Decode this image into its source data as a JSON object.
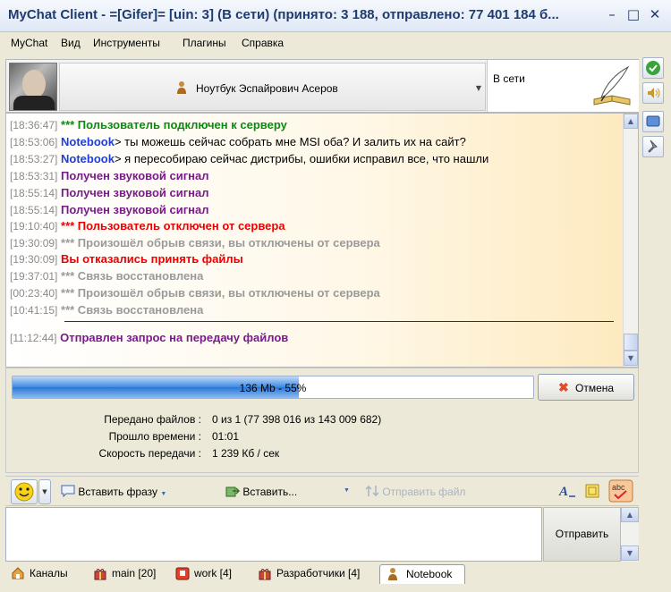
{
  "window": {
    "title": "MyChat Client - =[Gifer]= [uin: 3] (В сети) (принято: 3 188, отправлено: 77 401 184 б...",
    "minimize_glyph": "–",
    "maximize_glyph": "□",
    "close_glyph": "✕"
  },
  "menu": [
    "MyChat",
    "Вид",
    "Инструменты",
    "Плагины",
    "Справка"
  ],
  "header": {
    "contact_name": "Ноутбук Эспайрович Асеров",
    "status": "В сети"
  },
  "messages": [
    {
      "time": "[18:36:47]",
      "nick": "",
      "text": "*** Пользователь подключен к серверу",
      "style": "green"
    },
    {
      "time": "[18:53:06]",
      "nick": "Notebook",
      "text": "> ты можешь сейчас собрать мне MSI оба? И залить их на сайт?",
      "style": "black"
    },
    {
      "time": "[18:53:27]",
      "nick": "Notebook",
      "text": "> я пересобираю сейчас дистрибы, ошибки исправил все, что нашли",
      "style": "black"
    },
    {
      "time": "[18:53:31]",
      "nick": "",
      "text": "Получен звуковой сигнал",
      "style": "purple"
    },
    {
      "time": "[18:55:14]",
      "nick": "",
      "text": "Получен звуковой сигнал",
      "style": "purple"
    },
    {
      "time": "[18:55:14]",
      "nick": "",
      "text": "Получен звуковой сигнал",
      "style": "purple"
    },
    {
      "time": "[19:10:40]",
      "nick": "",
      "text": "*** Пользователь отключен от сервера",
      "style": "red"
    },
    {
      "time": "[19:30:09]",
      "nick": "",
      "text": "*** Произошёл обрыв связи, вы отключены от сервера",
      "style": "gray"
    },
    {
      "time": "[19:30:09]",
      "nick": "",
      "text": "Вы отказались принять файлы",
      "style": "red"
    },
    {
      "time": "[19:37:01]",
      "nick": "",
      "text": "*** Связь восстановлена",
      "style": "gray"
    },
    {
      "time": "[00:23:40]",
      "nick": "",
      "text": "*** Произошёл обрыв связи, вы отключены от сервера",
      "style": "gray"
    },
    {
      "time": "[10:41:15]",
      "nick": "",
      "text": "*** Связь восстановлена",
      "style": "gray"
    },
    {
      "time": "[11:12:44]",
      "nick": "",
      "text": "Отправлен запрос на передачу файлов",
      "style": "purple"
    }
  ],
  "transfer": {
    "progress_label": "136 Mb - 55%",
    "progress_fraction": 0.55,
    "cancel_label": "Отмена",
    "files_label": "Передано файлов :",
    "files_value": "0 из 1 (77 398 016 из 143 009 682)",
    "time_label": "Прошло времени :",
    "time_value": "01:01",
    "speed_label": "Скорость передачи :",
    "speed_value": "1 239 Кб / сек"
  },
  "toolbar": {
    "insert_phrase": "Вставить фразу",
    "insert": "Вставить...",
    "send_file": "Отправить файл",
    "dropdown_glyph": "▼"
  },
  "editor": {
    "value": "",
    "send_label": "Отправить"
  },
  "tabs": [
    {
      "label": "Каналы",
      "icon": "home-icon"
    },
    {
      "label": "main [20]",
      "icon": "gift-icon"
    },
    {
      "label": "work [4]",
      "icon": "folder-red-icon"
    },
    {
      "label": "Разработчики [4]",
      "icon": "gift-icon"
    },
    {
      "label": "Notebook",
      "icon": "user-icon"
    }
  ],
  "colors": {
    "accent": "#1e3c6e",
    "progress": "#2a77d6",
    "system_green": "#0c8a10",
    "signal_purple": "#7a1a8c",
    "alert_red": "#e00000",
    "muted_gray": "#9a9a9a",
    "nick_blue": "#1e3fd6"
  }
}
